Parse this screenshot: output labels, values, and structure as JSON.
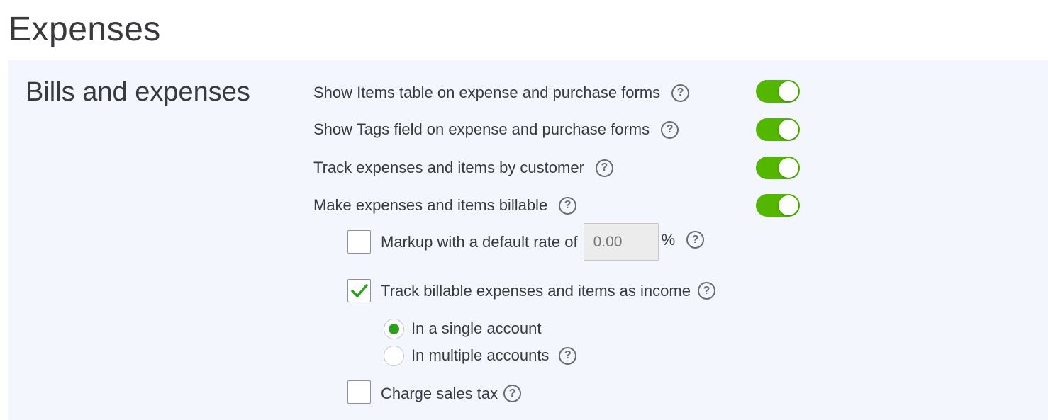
{
  "page": {
    "title": "Expenses"
  },
  "section": {
    "title": "Bills and expenses",
    "toggles": [
      {
        "label": "Show Items table on expense and purchase forms",
        "on": true
      },
      {
        "label": "Show Tags field on expense and purchase forms",
        "on": true
      },
      {
        "label": "Track expenses and items by customer",
        "on": true
      },
      {
        "label": "Make expenses and items billable",
        "on": true
      }
    ],
    "markup": {
      "label": "Markup with a default rate of",
      "placeholder": "0.00",
      "suffix": "%",
      "checked": false
    },
    "track_income": {
      "label": "Track billable expenses and items as income",
      "checked": true
    },
    "income_options": [
      {
        "label": "In a single account",
        "selected": true
      },
      {
        "label": "In multiple accounts",
        "selected": false
      }
    ],
    "sales_tax": {
      "label": "Charge sales tax",
      "checked": false
    }
  },
  "help_glyph": "?",
  "colors": {
    "toggle_on": "#53b700",
    "check": "#2ca01c",
    "panel_bg": "#f3f7fd"
  }
}
